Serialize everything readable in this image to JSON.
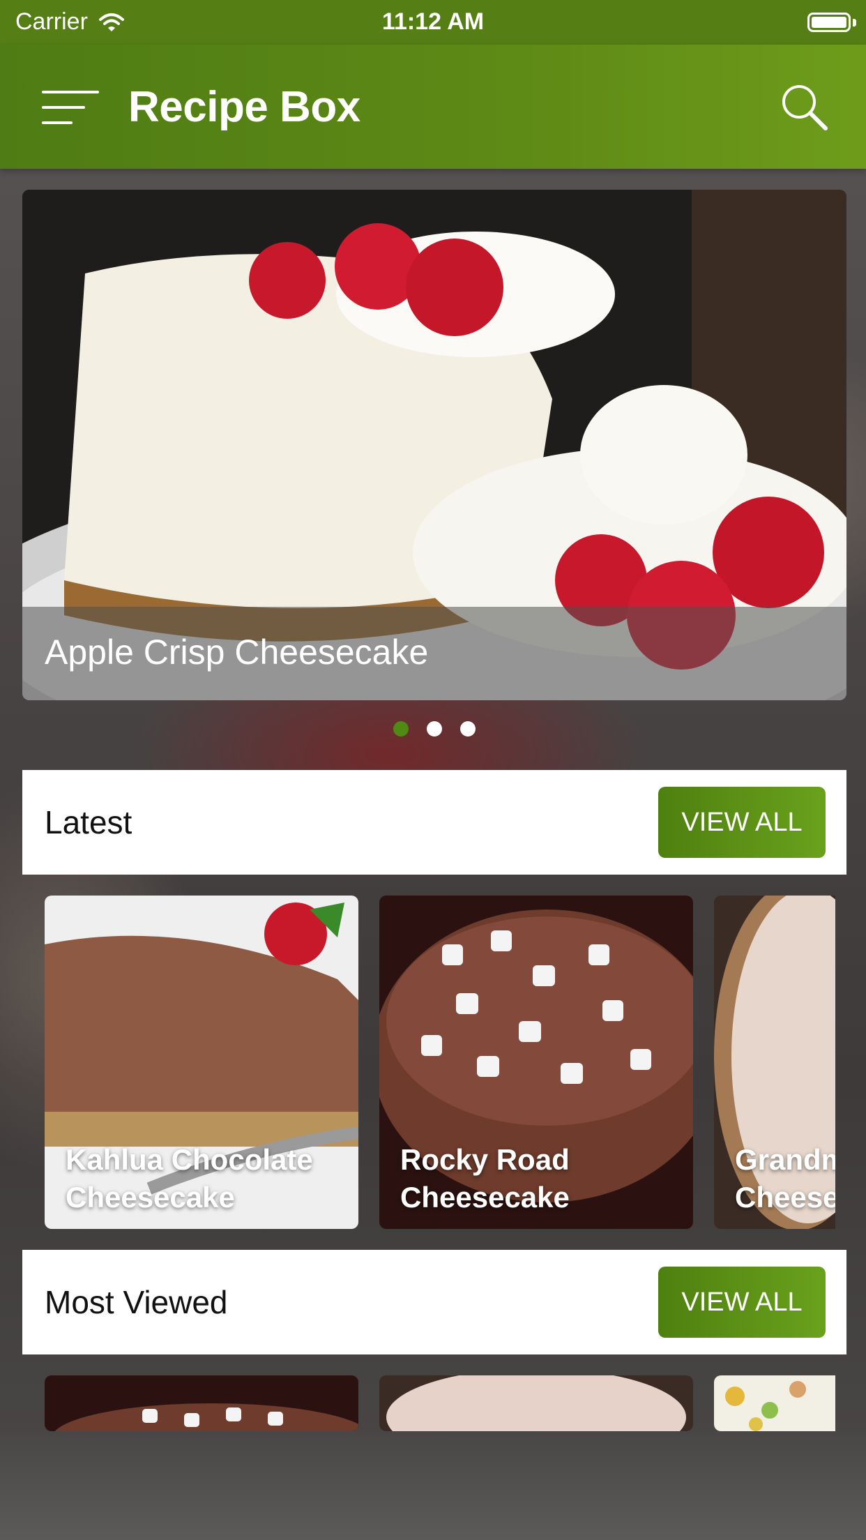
{
  "status_bar": {
    "carrier": "Carrier",
    "time": "11:12 AM"
  },
  "nav": {
    "title": "Recipe Box"
  },
  "hero": {
    "title": "Apple Crisp Cheesecake",
    "page_count": 3,
    "active_page": 1
  },
  "sections": {
    "latest": {
      "title": "Latest",
      "view_all": "VIEW ALL",
      "cards": [
        {
          "title": "Kahlua Chocolate Cheesecake"
        },
        {
          "title": "Rocky Road Cheesecake"
        },
        {
          "title": "Grandma's Bake Cheesecake"
        }
      ]
    },
    "most_viewed": {
      "title": "Most Viewed",
      "view_all": "VIEW ALL"
    }
  },
  "colors": {
    "brand_green": "#5e8a16",
    "active_dot": "#4f8a14"
  },
  "icons": {
    "menu": "hamburger-icon",
    "search": "search-icon",
    "signal": "wifi-icon",
    "battery": "battery-icon"
  }
}
